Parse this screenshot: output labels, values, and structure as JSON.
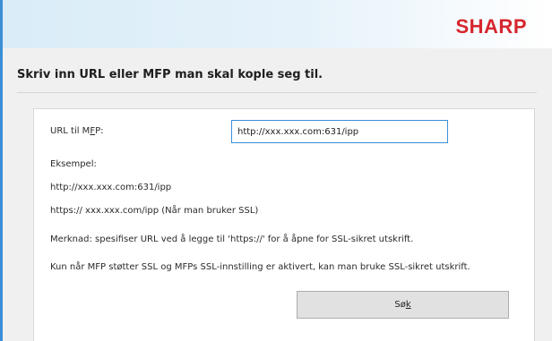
{
  "header": {
    "logo_text": "SHARP",
    "logo_color": "#d6262e",
    "accent_color": "#3a8fd6"
  },
  "main": {
    "heading": "Skriv inn URL eller MFP man skal kople seg til.",
    "url_label_pre": "URL til M",
    "url_label_accel": "F",
    "url_label_post": "P:",
    "url_value": "http://xxx.xxx.com:631/ipp",
    "example_label": "Eksempel:",
    "example_http": "http://xxx.xxx.com:631/ipp",
    "example_https": "https:// xxx.xxx.com/ipp (Når man bruker SSL)",
    "note": "Merknad: spesifiser URL ved å legge til 'https://' for å åpne for SSL-sikret utskrift.",
    "ssl_info": "Kun når MFP støtter SSL og MFPs SSL-innstilling er aktivert, kan man bruke SSL-sikret utskrift.",
    "search_label_pre": "Sø",
    "search_label_accel": "k"
  }
}
